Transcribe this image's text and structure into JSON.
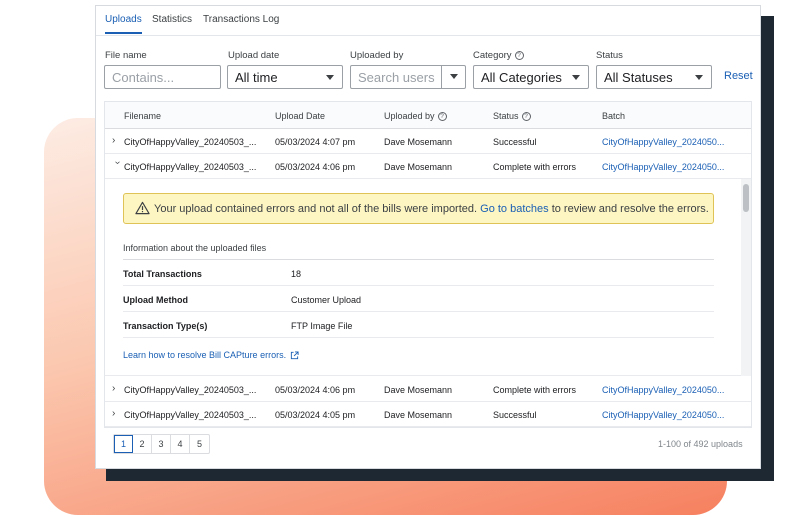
{
  "tabs": [
    {
      "label": "Uploads",
      "active": true
    },
    {
      "label": "Statistics",
      "active": false
    },
    {
      "label": "Transactions Log",
      "active": false
    }
  ],
  "filters": {
    "file_name": {
      "label": "File name",
      "placeholder": "Contains..."
    },
    "upload_date": {
      "label": "Upload date",
      "value": "All time"
    },
    "uploaded_by": {
      "label": "Uploaded by",
      "placeholder": "Search users"
    },
    "category": {
      "label": "Category",
      "value": "All Categories"
    },
    "status": {
      "label": "Status",
      "value": "All Statuses"
    },
    "reset_label": "Reset"
  },
  "table": {
    "columns": [
      "Filename",
      "Upload Date",
      "Uploaded by",
      "Status",
      "Batch"
    ],
    "rows": [
      {
        "filename": "CityOfHappyValley_20240503_...",
        "upload_date": "05/03/2024 4:07 pm",
        "uploaded_by": "Dave Mosemann",
        "status": "Successful",
        "batch": "CityOfHappyValley_2024050...",
        "expanded": false
      },
      {
        "filename": "CityOfHappyValley_20240503_...",
        "upload_date": "05/03/2024 4:06 pm",
        "uploaded_by": "Dave Mosemann",
        "status": "Complete with errors",
        "batch": "CityOfHappyValley_2024050...",
        "expanded": true
      },
      {
        "filename": "CityOfHappyValley_20240503_...",
        "upload_date": "05/03/2024 4:06 pm",
        "uploaded_by": "Dave Mosemann",
        "status": "Complete with errors",
        "batch": "CityOfHappyValley_2024050...",
        "expanded": false
      },
      {
        "filename": "CityOfHappyValley_20240503_...",
        "upload_date": "05/03/2024 4:05 pm",
        "uploaded_by": "Dave Mosemann",
        "status": "Successful",
        "batch": "CityOfHappyValley_2024050...",
        "expanded": false
      }
    ]
  },
  "details": {
    "alert_before": "Your upload contained errors and not all of the bills were imported.",
    "alert_link": "Go to batches",
    "alert_after": "to review and resolve the errors.",
    "info_title": "Information about the uploaded files",
    "items": [
      {
        "key": "Total Transactions",
        "value": "18"
      },
      {
        "key": "Upload Method",
        "value": "Customer Upload"
      },
      {
        "key": "Transaction Type(s)",
        "value": "FTP Image File"
      }
    ],
    "learn_link": "Learn how to resolve Bill CAPture errors."
  },
  "pagination": {
    "pages": [
      "1",
      "2",
      "3",
      "4",
      "5"
    ],
    "current_page": "1",
    "count_text": "1-100 of 492 uploads"
  },
  "icons": {
    "help": "question-circle-icon",
    "warning": "warning-triangle-icon",
    "external": "external-link-icon",
    "expand": "chevron-right-icon",
    "collapse": "chevron-down-icon"
  },
  "colors": {
    "accent": "#1a5fb4",
    "alert_bg": "#fdf6c3",
    "alert_border": "#e0c356"
  }
}
